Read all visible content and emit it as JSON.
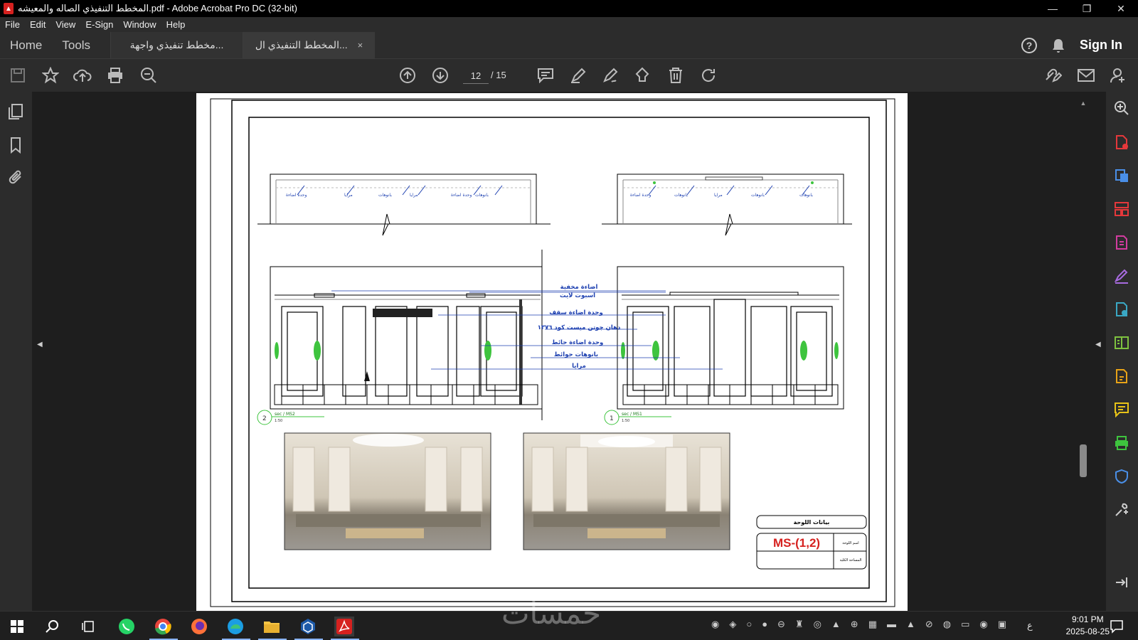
{
  "window": {
    "title": "المخطط التنفيذي الصاله والمعيشه.pdf - Adobe Acrobat Pro DC (32-bit)",
    "minimize": "—",
    "restore": "❐",
    "close": "✕"
  },
  "menu": [
    "File",
    "Edit",
    "View",
    "E-Sign",
    "Window",
    "Help"
  ],
  "tabs": {
    "home": "Home",
    "tools": "Tools",
    "doc1": "مخطط تنفيذي واجهة...",
    "doc2": "المخطط التنفيذي ال...",
    "close": "×",
    "help": "?",
    "signin": "Sign In"
  },
  "toolbar": {
    "current_page": "12",
    "total_pages": "/ 15"
  },
  "drawing": {
    "labels": [
      "اضاءة مخفية",
      "اسبوت لايت",
      "وحدة اضاءة سقف",
      "دهان جوتن ميست كود ١٣٧٦",
      "وحدة اضاءة حائط",
      "بانوهات حوائط",
      "مرايا"
    ],
    "top_labels_left": [
      "وحدة اضاءة",
      "مرايا",
      "بانوهات",
      "مرايا",
      "وحدة اضاءة",
      "بانوهات"
    ],
    "top_labels_right": [
      "وحدة اضاءة",
      "بانوهات",
      "مرايا",
      "بانوهات",
      "بانوهات"
    ],
    "section_left_num": "2",
    "section_left_tag": "sec / MS2",
    "section_right_num": "1",
    "section_right_tag": "sec / MS1",
    "scale": "1:50",
    "title_block_header": "بيانات اللوحة",
    "sheet_code": "MS-(1,2)",
    "sheet_name_label": "اسم اللوحة",
    "scale_label": "المساحة الكلية"
  },
  "taskbar": {
    "time": "9:01 PM",
    "date": "2025-08-25",
    "lang": "ع"
  },
  "colors": {
    "accent_red": "#d6211f",
    "dim_blue": "#1c3fb0",
    "plant_green": "#3ec43e"
  },
  "watermark": "خمسات"
}
